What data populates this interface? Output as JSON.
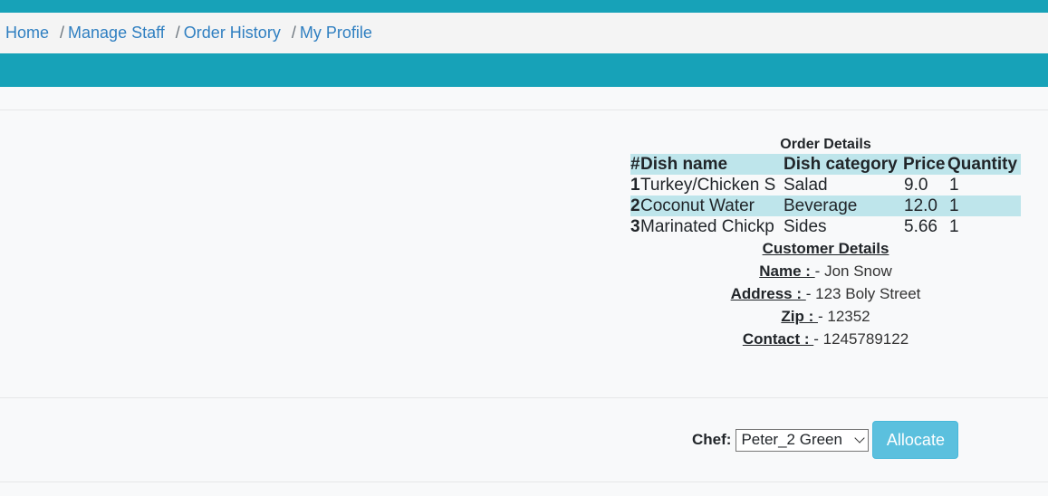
{
  "nav": {
    "items": [
      {
        "label": "Home"
      },
      {
        "label": "Manage Staff"
      },
      {
        "label": "Order History"
      },
      {
        "label": "My Profile"
      }
    ],
    "separator": "/"
  },
  "order": {
    "title": "Order Details",
    "headers": {
      "num": "#",
      "name": "Dish name",
      "category": "Dish category",
      "price": "Price",
      "qty": "Quantity"
    },
    "rows": [
      {
        "num": "1",
        "name": "Turkey/Chicken S",
        "category": "Salad",
        "price": "9.0",
        "qty": "1"
      },
      {
        "num": "2",
        "name": "Coconut Water",
        "category": "Beverage",
        "price": "12.0",
        "qty": "1"
      },
      {
        "num": "3",
        "name": "Marinated Chickp",
        "category": "Sides",
        "price": "5.66",
        "qty": "1"
      }
    ]
  },
  "customer": {
    "title": "Customer Details",
    "separator": " - ",
    "fields": [
      {
        "label": "Name : ",
        "value": "Jon Snow"
      },
      {
        "label": "Address : ",
        "value": "123 Boly Street"
      },
      {
        "label": "Zip : ",
        "value": "12352"
      },
      {
        "label": "Contact : ",
        "value": "1245789122"
      }
    ]
  },
  "allocate": {
    "chef_label": "Chef:",
    "chef_selected": "Peter_2 Green",
    "button_label": "Allocate"
  },
  "colors": {
    "accent": "#17a2b8",
    "row_highlight": "#bee5eb",
    "link": "#2f7fc1",
    "button": "#5bc0de"
  }
}
